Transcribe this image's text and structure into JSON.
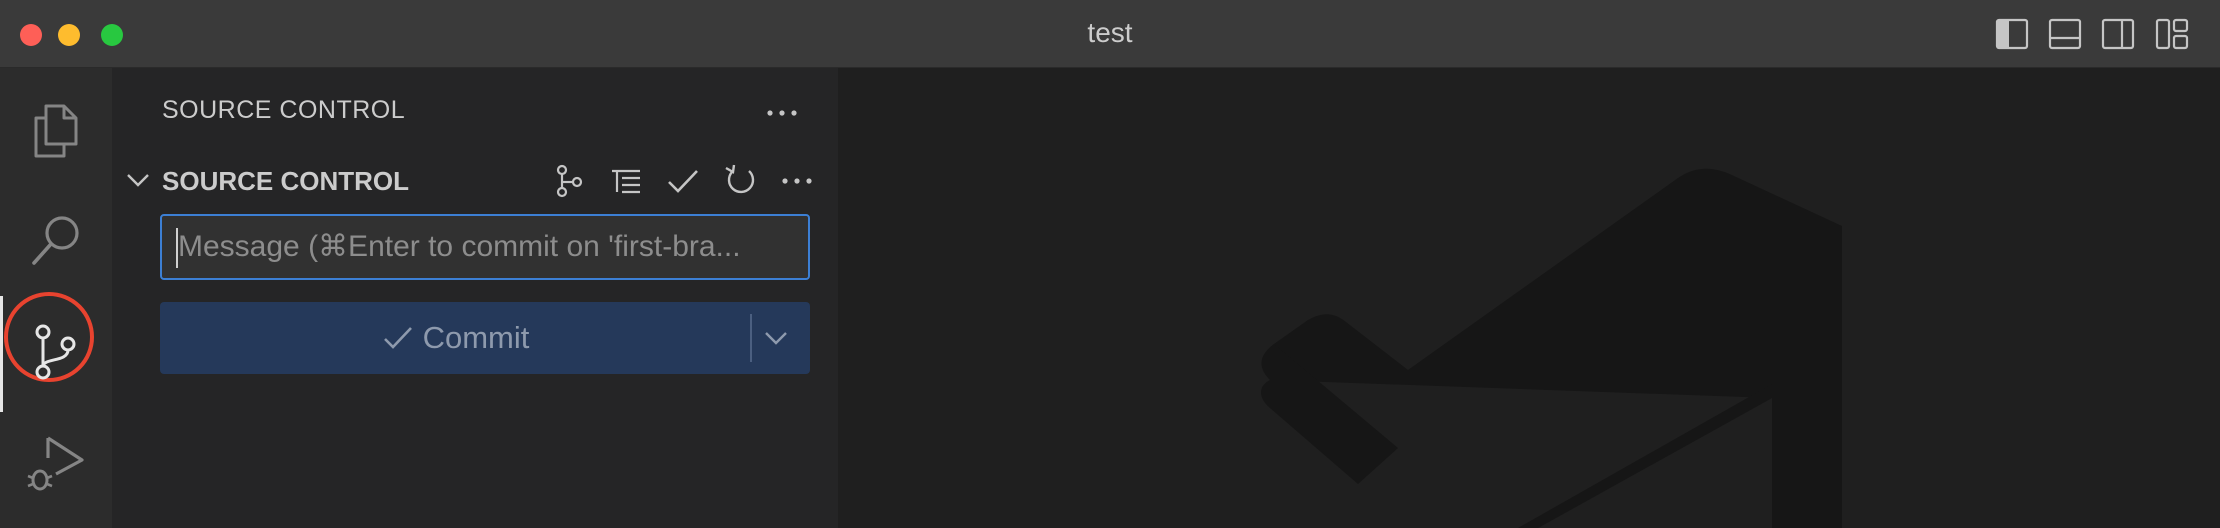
{
  "window": {
    "title": "test"
  },
  "titlebar_controls": [
    {
      "icon": "toggle-primary-sidebar-icon"
    },
    {
      "icon": "toggle-panel-icon"
    },
    {
      "icon": "toggle-secondary-sidebar-icon"
    },
    {
      "icon": "customize-layout-icon"
    }
  ],
  "activity_bar": {
    "items": [
      {
        "icon": "explorer-files-icon"
      },
      {
        "icon": "search-icon"
      },
      {
        "icon": "source-control-icon",
        "active": true
      },
      {
        "icon": "run-and-debug-icon"
      }
    ]
  },
  "sidebar": {
    "title": "SOURCE CONTROL",
    "section": {
      "title": "SOURCE CONTROL",
      "actions": [
        {
          "icon": "view-graph-icon"
        },
        {
          "icon": "view-as-tree-icon"
        },
        {
          "icon": "commit-check-icon"
        },
        {
          "icon": "refresh-icon"
        },
        {
          "icon": "more-actions-icon"
        }
      ]
    },
    "commit_message": {
      "value": "",
      "placeholder": "Message (⌘Enter to commit on 'first-bra..."
    },
    "commit_button": {
      "label": "Commit"
    }
  },
  "colors": {
    "accent": "#3c7fd4",
    "commit_button_bg": "#25395a",
    "highlight_ring": "#e8432f"
  }
}
